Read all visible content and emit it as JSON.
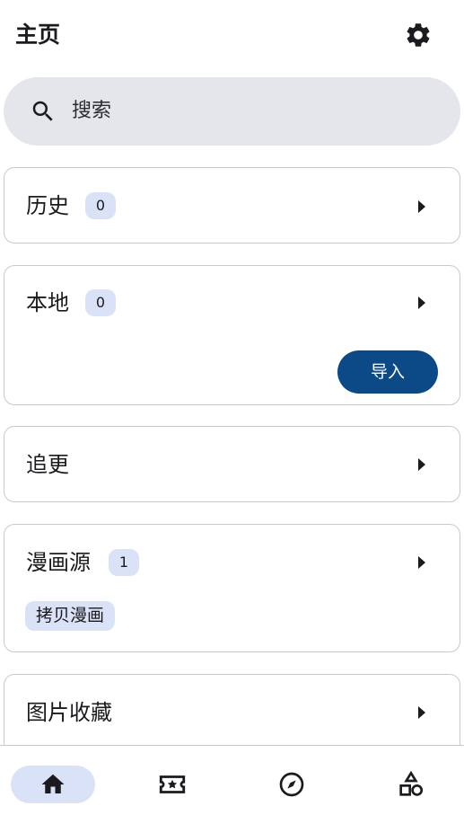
{
  "header": {
    "title": "主页",
    "settings_icon": "gear-icon"
  },
  "search": {
    "placeholder": "搜索",
    "icon": "search-icon"
  },
  "cards": {
    "history": {
      "title": "历史",
      "count": "0"
    },
    "local": {
      "title": "本地",
      "count": "0",
      "import_label": "导入"
    },
    "follow": {
      "title": "追更"
    },
    "sources": {
      "title": "漫画源",
      "count": "1",
      "chips": [
        "拷贝漫画"
      ]
    },
    "favorites": {
      "title": "图片收藏"
    }
  },
  "bottom_nav": {
    "items": [
      {
        "icon": "home-icon",
        "active": true
      },
      {
        "icon": "ticket-star-icon",
        "active": false
      },
      {
        "icon": "compass-icon",
        "active": false
      },
      {
        "icon": "shapes-icon",
        "active": false
      }
    ]
  },
  "colors": {
    "accent": "#0b4a86",
    "badge_bg": "#d9e2f6",
    "search_bg": "#e4e6eb"
  }
}
